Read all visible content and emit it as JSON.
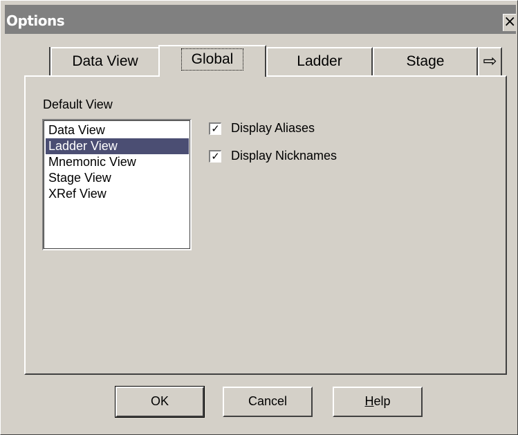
{
  "window": {
    "title": "Options",
    "close_glyph": "×"
  },
  "tabs": [
    {
      "label": "Data View"
    },
    {
      "label": "Global",
      "selected": true
    },
    {
      "label": "Ladder"
    },
    {
      "label": "Stage"
    }
  ],
  "tab_scroll_icon": "right-arrow-icon",
  "default_view": {
    "label": "Default View",
    "items": [
      "Data View",
      "Ladder View",
      "Mnemonic View",
      "Stage View",
      "XRef View"
    ],
    "selected": "Ladder View"
  },
  "options": {
    "display_aliases": {
      "label": "Display Aliases",
      "checked": true
    },
    "display_nicknames": {
      "label": "Display Nicknames",
      "checked": true
    }
  },
  "buttons": {
    "ok": "OK",
    "cancel": "Cancel",
    "help_mnemonic": "H",
    "help_rest": "elp"
  },
  "colors": {
    "face": "#d4d0c8",
    "titlebar": "#808080",
    "selection": "#4b4e73"
  }
}
